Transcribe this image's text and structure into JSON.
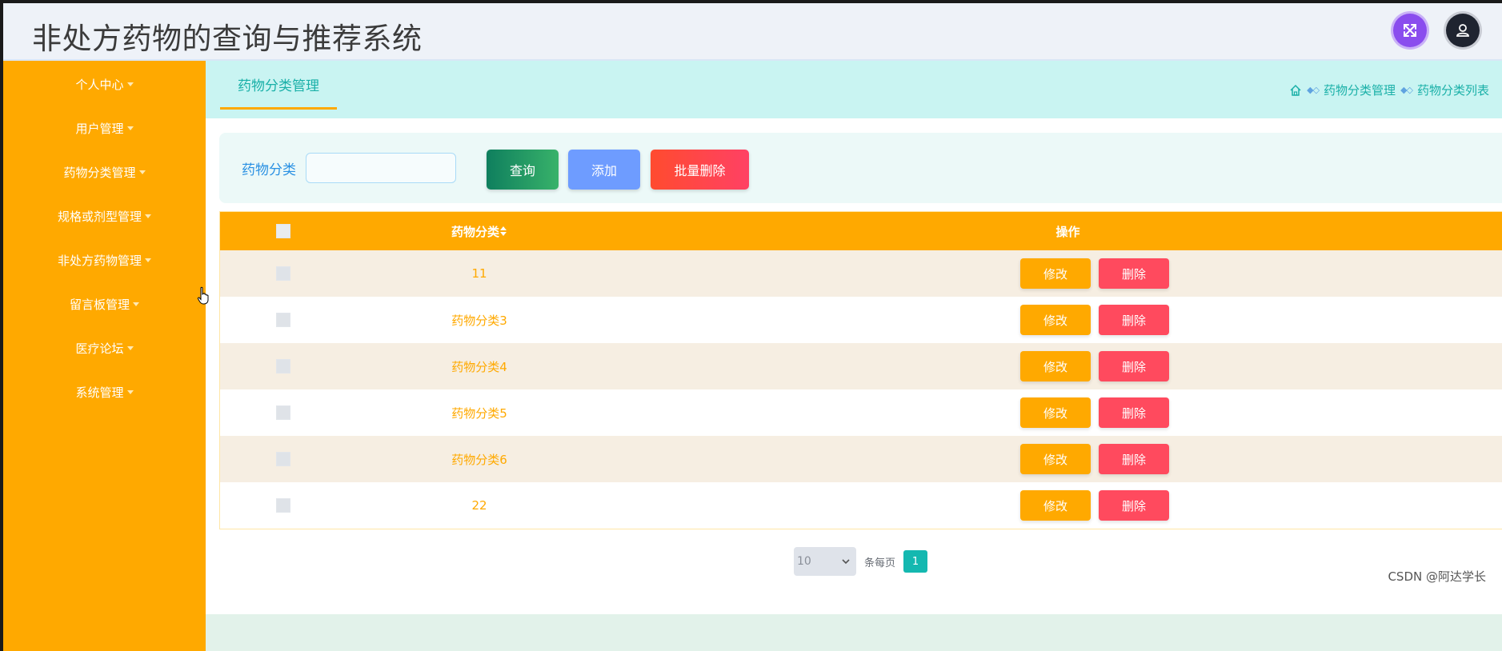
{
  "header": {
    "title": "非处方药物的查询与推荐系统",
    "expand_icon": "expand-arrows-icon",
    "user_icon": "user-icon",
    "colors": {
      "expand": "#8a4dee",
      "user": "#1f2430"
    }
  },
  "sidebar": {
    "bg": "#ffa900",
    "items": [
      {
        "label": "个人中心"
      },
      {
        "label": "用户管理"
      },
      {
        "label": "药物分类管理"
      },
      {
        "label": "规格或剂型管理"
      },
      {
        "label": "非处方药物管理"
      },
      {
        "label": "留言板管理"
      },
      {
        "label": "医疗论坛"
      },
      {
        "label": "系统管理"
      }
    ]
  },
  "main": {
    "active_tab": "药物分类管理",
    "breadcrumb": {
      "home_icon": "home-icon",
      "items": [
        "药物分类管理",
        "药物分类列表"
      ]
    },
    "search": {
      "label": "药物分类",
      "value": "",
      "placeholder": "",
      "query_label": "查询",
      "add_label": "添加",
      "batch_delete_label": "批量删除"
    },
    "table": {
      "columns": [
        "药物分类",
        "操作"
      ],
      "sort_icon": "sort-icon",
      "rows": [
        {
          "name": "11"
        },
        {
          "name": "药物分类3"
        },
        {
          "name": "药物分类4"
        },
        {
          "name": "药物分类5"
        },
        {
          "name": "药物分类6"
        },
        {
          "name": "22"
        }
      ],
      "edit_label": "修改",
      "delete_label": "删除"
    },
    "pagination": {
      "page_size": "10",
      "per_page_text": "条每页",
      "current_page": "1"
    }
  },
  "watermark": "CSDN @阿达学长",
  "colors": {
    "accent": "#ffa900",
    "teal": "#14b8b0",
    "danger": "#ff4a5e"
  }
}
